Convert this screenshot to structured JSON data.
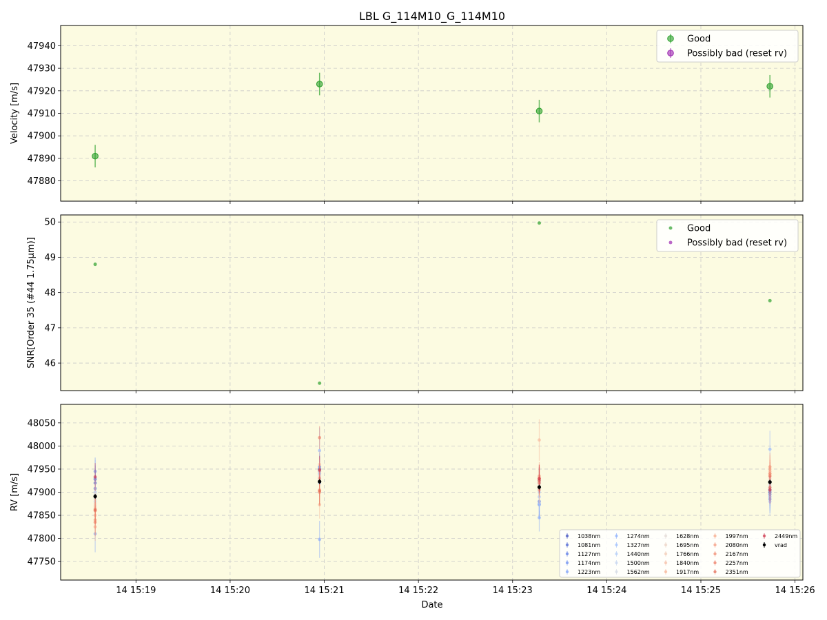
{
  "title": "LBL G_114M10_G_114M10",
  "xlabel": "Date",
  "x_ticks": [
    "14 15:19",
    "14 15:20",
    "14 15:21",
    "14 15:22",
    "14 15:23",
    "14 15:24",
    "14 15:25",
    "14 15:26"
  ],
  "colors": {
    "background": "#fcfbe1",
    "good": "#2ca02c",
    "bad": "#9c27b0",
    "grid": "#c8c8c8"
  },
  "chart_data": [
    {
      "type": "scatter",
      "panel": "velocity",
      "ylabel": "Velocity [m/s]",
      "xlim": [
        "15:18:12",
        "15:26:05"
      ],
      "ylim": [
        47871,
        47949
      ],
      "yticks": [
        47880,
        47890,
        47900,
        47910,
        47920,
        47930,
        47940
      ],
      "grid": true,
      "legend_position": "top-right",
      "legend": [
        "Good",
        "Possibly bad (reset rv)"
      ],
      "series": [
        {
          "name": "Good",
          "points": [
            {
              "x": "15:18:34",
              "y": 47891,
              "err": 5
            },
            {
              "x": "15:20:57",
              "y": 47923,
              "err": 5
            },
            {
              "x": "15:23:17",
              "y": 47911,
              "err": 5
            },
            {
              "x": "15:25:44",
              "y": 47922,
              "err": 5
            }
          ]
        },
        {
          "name": "Possibly bad (reset rv)",
          "points": []
        }
      ]
    },
    {
      "type": "scatter",
      "panel": "snr",
      "ylabel": "SNR[Order 35 (#44 1.75μm)]",
      "xlim": [
        "15:18:12",
        "15:26:05"
      ],
      "ylim": [
        45.22,
        50.2
      ],
      "yticks": [
        46,
        47,
        48,
        49,
        50
      ],
      "grid": true,
      "legend_position": "top-right",
      "legend": [
        "Good",
        "Possibly bad (reset rv)"
      ],
      "series": [
        {
          "name": "Good",
          "points": [
            {
              "x": "15:18:34",
              "y": 48.8
            },
            {
              "x": "15:20:57",
              "y": 45.43
            },
            {
              "x": "15:23:17",
              "y": 49.97
            },
            {
              "x": "15:25:44",
              "y": 47.77
            }
          ]
        },
        {
          "name": "Possibly bad (reset rv)",
          "points": []
        }
      ]
    },
    {
      "type": "scatter",
      "panel": "rv",
      "ylabel": "RV [m/s]",
      "xlim": [
        "15:18:12",
        "15:26:05"
      ],
      "ylim": [
        47710,
        48090
      ],
      "yticks": [
        47750,
        47800,
        47850,
        47900,
        47950,
        48000,
        48050
      ],
      "grid": true,
      "legend_position": "bottom-right",
      "legend": [
        "1038nm",
        "1081nm",
        "1127nm",
        "1174nm",
        "1223nm",
        "1274nm",
        "1327nm",
        "1440nm",
        "1500nm",
        "1562nm",
        "1628nm",
        "1695nm",
        "1766nm",
        "1840nm",
        "1917nm",
        "1997nm",
        "2080nm",
        "2167nm",
        "2257nm",
        "2351nm",
        "2449nm",
        "vrad"
      ],
      "x": [
        "15:18:34",
        "15:20:57",
        "15:23:17",
        "15:25:44"
      ],
      "series": [
        {
          "name": "1038nm",
          "color": "#3b4cc0",
          "y": [
            47928,
            47950,
            47925,
            47900
          ],
          "err": [
            30,
            30,
            30,
            30
          ]
        },
        {
          "name": "1081nm",
          "color": "#4a63d3",
          "y": [
            47920,
            47945,
            47920,
            47905
          ],
          "err": [
            30,
            30,
            30,
            30
          ]
        },
        {
          "name": "1127nm",
          "color": "#5b7ae5",
          "y": [
            47908,
            47955,
            47880,
            47895
          ],
          "err": [
            30,
            30,
            30,
            30
          ]
        },
        {
          "name": "1174nm",
          "color": "#6c8ff1",
          "y": [
            47945,
            47940,
            47873,
            47885
          ],
          "err": [
            30,
            30,
            30,
            30
          ]
        },
        {
          "name": "1223nm",
          "color": "#7ea1fa",
          "y": [
            47810,
            47798,
            47845,
            47890
          ],
          "err": [
            40,
            40,
            30,
            30
          ]
        },
        {
          "name": "1274nm",
          "color": "#90b2fe",
          "y": [
            47930,
            47990,
            47875,
            47993
          ],
          "err": [
            40,
            50,
            30,
            40
          ]
        },
        {
          "name": "1327nm",
          "color": "#a3c2fe",
          "y": [
            47900,
            47920,
            47890,
            47880
          ],
          "err": [
            30,
            30,
            30,
            30
          ]
        },
        {
          "name": "1440nm",
          "color": "#b5cef8",
          "y": [
            47890,
            47930,
            47900,
            47910
          ],
          "err": [
            30,
            30,
            30,
            30
          ]
        },
        {
          "name": "1500nm",
          "color": "#c6d6f1",
          "y": [
            47880,
            47935,
            47905,
            47915
          ],
          "err": [
            30,
            30,
            30,
            30
          ]
        },
        {
          "name": "1562nm",
          "color": "#d5dbe5",
          "y": [
            47895,
            47940,
            47910,
            47920
          ],
          "err": [
            30,
            30,
            30,
            30
          ]
        },
        {
          "name": "1628nm",
          "color": "#e2dad5",
          "y": [
            47885,
            47925,
            47915,
            47925
          ],
          "err": [
            30,
            30,
            30,
            30
          ]
        },
        {
          "name": "1695nm",
          "color": "#ecd3c5",
          "y": [
            47875,
            47935,
            47920,
            47930
          ],
          "err": [
            30,
            30,
            30,
            30
          ]
        },
        {
          "name": "1766nm",
          "color": "#f2cab5",
          "y": [
            47870,
            47945,
            47925,
            47935
          ],
          "err": [
            30,
            30,
            30,
            30
          ]
        },
        {
          "name": "1840nm",
          "color": "#f6bfa6",
          "y": [
            47865,
            47960,
            47930,
            47940
          ],
          "err": [
            30,
            30,
            30,
            30
          ]
        },
        {
          "name": "1917nm",
          "color": "#f7b396",
          "y": [
            47850,
            47873,
            48013,
            47945
          ],
          "err": [
            30,
            30,
            45,
            30
          ]
        },
        {
          "name": "1997nm",
          "color": "#f7a688",
          "y": [
            47825,
            47905,
            47905,
            47950
          ],
          "err": [
            30,
            30,
            30,
            30
          ]
        },
        {
          "name": "2080nm",
          "color": "#f5977a",
          "y": [
            47840,
            47930,
            47935,
            47955
          ],
          "err": [
            30,
            30,
            30,
            30
          ]
        },
        {
          "name": "2167nm",
          "color": "#f1886c",
          "y": [
            47835,
            47900,
            47920,
            47940
          ],
          "err": [
            30,
            30,
            30,
            30
          ]
        },
        {
          "name": "2257nm",
          "color": "#ec785f",
          "y": [
            47860,
            48018,
            47930,
            47935
          ],
          "err": [
            30,
            25,
            30,
            30
          ]
        },
        {
          "name": "2351nm",
          "color": "#e36852",
          "y": [
            47862,
            47903,
            47925,
            47910
          ],
          "err": [
            30,
            30,
            30,
            30
          ]
        },
        {
          "name": "2449nm",
          "color": "#cc2f46",
          "y": [
            47933,
            47948,
            47929,
            47905
          ],
          "err": [
            30,
            30,
            30,
            30
          ]
        },
        {
          "name": "vrad",
          "color": "#000000",
          "y": [
            47891,
            47923,
            47911,
            47922
          ],
          "err": [
            5,
            5,
            5,
            5
          ]
        }
      ]
    }
  ]
}
